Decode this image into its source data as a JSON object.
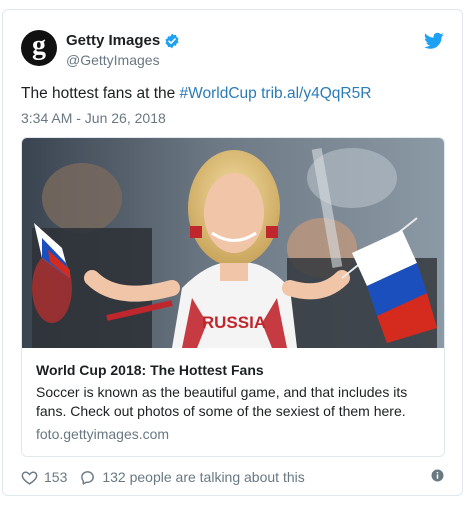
{
  "account": {
    "display_name": "Getty Images",
    "handle": "@GettyImages",
    "avatar_letter": "g"
  },
  "tweet": {
    "text_plain": "The hottest fans at the ",
    "hashtag": "#WorldCup",
    "link": "trib.al/y4QqR5R",
    "timestamp": "3:34 AM - Jun 26, 2018"
  },
  "card": {
    "title": "World Cup 2018: The Hottest Fans",
    "description": "Soccer is known as the beautiful game, and that includes its fans. Check out photos of some of the sexiest of them here.",
    "domain": "foto.gettyimages.com",
    "image_jersey_text": "RUSSIA"
  },
  "actions": {
    "like_count": "153",
    "talk_text": "132 people are talking about this"
  },
  "colors": {
    "link": "#2b7bb9",
    "twitter_blue": "#1da1f2",
    "muted": "#697882",
    "border": "#e1e8ed"
  },
  "icons": [
    "verified-badge-icon",
    "twitter-bird-icon",
    "heart-icon",
    "reply-bubble-icon",
    "info-icon"
  ]
}
